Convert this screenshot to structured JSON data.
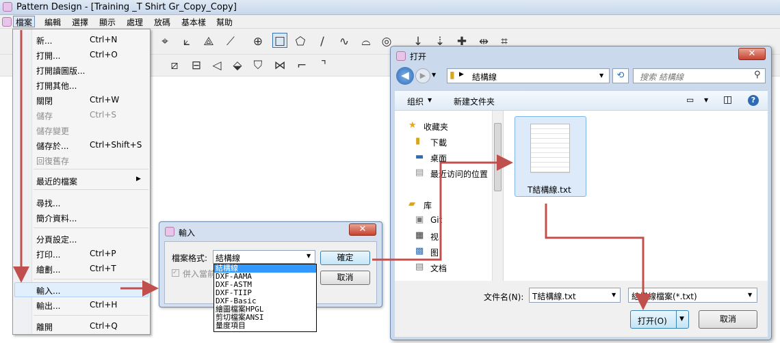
{
  "app": {
    "title": "Pattern Design - [Training _T Shirt Gr_Copy_Copy]"
  },
  "menubar": [
    {
      "label": "檔案",
      "active": true
    },
    {
      "label": "編輯"
    },
    {
      "label": "選擇"
    },
    {
      "label": "顯示"
    },
    {
      "label": "處理"
    },
    {
      "label": "放碼"
    },
    {
      "label": "基本樣"
    },
    {
      "label": "幫助"
    }
  ],
  "file_menu": {
    "items": [
      {
        "label": "新...",
        "shortcut": "Ctrl+N",
        "enabled": true
      },
      {
        "label": "打開...",
        "shortcut": "Ctrl+O",
        "enabled": true
      },
      {
        "label": "打開讀圖版...",
        "shortcut": "",
        "enabled": true
      },
      {
        "label": "打開其他...",
        "shortcut": "",
        "enabled": true
      },
      {
        "label": "關閉",
        "shortcut": "Ctrl+W",
        "enabled": true
      },
      {
        "label": "儲存",
        "shortcut": "Ctrl+S",
        "enabled": false
      },
      {
        "label": "儲存變更",
        "shortcut": "",
        "enabled": false
      },
      {
        "label": "儲存於...",
        "shortcut": "Ctrl+Shift+S",
        "enabled": true
      },
      {
        "label": "回復舊存",
        "shortcut": "",
        "enabled": false
      },
      {
        "label": "最近的檔案",
        "shortcut": "",
        "enabled": true,
        "submenu": true
      },
      {
        "label": "尋找...",
        "shortcut": "",
        "enabled": true
      },
      {
        "label": "簡介資料...",
        "shortcut": "",
        "enabled": true
      },
      {
        "label": "分頁設定...",
        "shortcut": "",
        "enabled": true
      },
      {
        "label": "打印...",
        "shortcut": "Ctrl+P",
        "enabled": true
      },
      {
        "label": "繪劃...",
        "shortcut": "Ctrl+T",
        "enabled": true
      },
      {
        "label": "輸入...",
        "shortcut": "",
        "enabled": true,
        "highlighted": true
      },
      {
        "label": "輸出...",
        "shortcut": "Ctrl+H",
        "enabled": true
      },
      {
        "label": "離開",
        "shortcut": "Ctrl+Q",
        "enabled": true
      }
    ]
  },
  "import_dialog": {
    "title": "輸入",
    "format_label": "檔案格式:",
    "format_value": "結構線",
    "merge_label": "併入當前",
    "ok_label": "確定",
    "cancel_label": "取消",
    "options": [
      "結構線",
      "DXF-AAMA",
      "DXF-ASTM",
      "DXF-TIIP",
      "DXF-Basic",
      "繪圖檔案HPGL",
      "剪切檔案ANSI",
      "量度項目"
    ]
  },
  "open_dialog": {
    "title": "打开",
    "path": "結構線",
    "search_placeholder": "搜索 結構線",
    "organize_label": "组织",
    "new_folder_label": "新建文件夹",
    "nav": {
      "favorites_label": "收藏夹",
      "favorites": [
        {
          "label": "下載",
          "icon": "download-folder-icon"
        },
        {
          "label": "桌面",
          "icon": "desktop-icon"
        },
        {
          "label": "最近访问的位置",
          "icon": "recent-places-icon"
        }
      ],
      "libraries_label": "库",
      "libraries": [
        {
          "label": "Git",
          "icon": "git-library-icon"
        },
        {
          "label": "视",
          "icon": "videos-library-icon"
        },
        {
          "label": "图",
          "icon": "pictures-library-icon"
        },
        {
          "label": "文档",
          "icon": "documents-library-icon"
        }
      ]
    },
    "file": {
      "name": "T結構線.txt"
    },
    "filename_label": "文件名(N):",
    "filename_value": "T結構線.txt",
    "filetype_value": "結構線檔案(*.txt)",
    "open_label": "打开(O)",
    "cancel_label": "取消"
  },
  "colors": {
    "arrow": "#c0504d",
    "accent": "#3399ff"
  }
}
